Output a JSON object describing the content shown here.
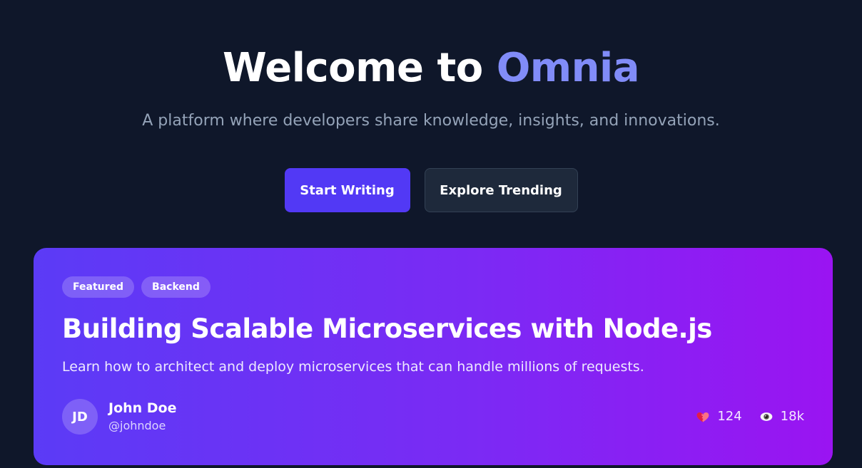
{
  "hero": {
    "title_prefix": "Welcome to ",
    "title_accent": "Omnia",
    "subtitle": "A platform where developers share knowledge, insights, and innovations."
  },
  "actions": {
    "primary_label": "Start Writing",
    "secondary_label": "Explore Trending"
  },
  "featured_post": {
    "tags": [
      "Featured",
      "Backend"
    ],
    "title": "Building Scalable Microservices with Node.js",
    "description": "Learn how to architect and deploy microservices that can handle millions of requests.",
    "author": {
      "initials": "JD",
      "name": "John Doe",
      "handle": "@johndoe"
    },
    "stats": {
      "likes": "124",
      "likes_icon": "heart-icon",
      "views": "18k",
      "views_icon": "eye-icon"
    }
  },
  "colors": {
    "background": "#0f172a",
    "accent": "#818cf8",
    "primary_button": "#5239f5",
    "card_gradient_start": "#5b3bf6",
    "card_gradient_end": "#9a14f2"
  }
}
